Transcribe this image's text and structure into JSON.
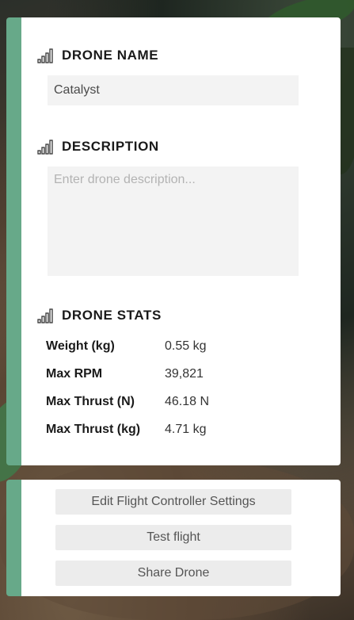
{
  "drone_name": {
    "heading": "DRONE NAME",
    "icon": "signal-bars-icon",
    "value": "Catalyst"
  },
  "description": {
    "heading": "DESCRIPTION",
    "icon": "signal-bars-icon",
    "value": "",
    "placeholder": "Enter drone description..."
  },
  "drone_stats": {
    "heading": "DRONE STATS",
    "icon": "signal-bars-icon",
    "rows": [
      {
        "label": "Weight (kg)",
        "value": "0.55 kg"
      },
      {
        "label": "Max RPM",
        "value": "39,821"
      },
      {
        "label": "Max Thrust (N)",
        "value": "46.18 N"
      },
      {
        "label": "Max Thrust (kg)",
        "value": "4.71 kg"
      }
    ]
  },
  "actions": {
    "edit_fc_label": "Edit Flight Controller Settings",
    "test_flight_label": "Test flight",
    "share_label": "Share Drone"
  },
  "colors": {
    "accent": "#67a989",
    "panel": "#ffffff",
    "field_bg": "#f3f3f3",
    "button_bg": "#ececec"
  }
}
